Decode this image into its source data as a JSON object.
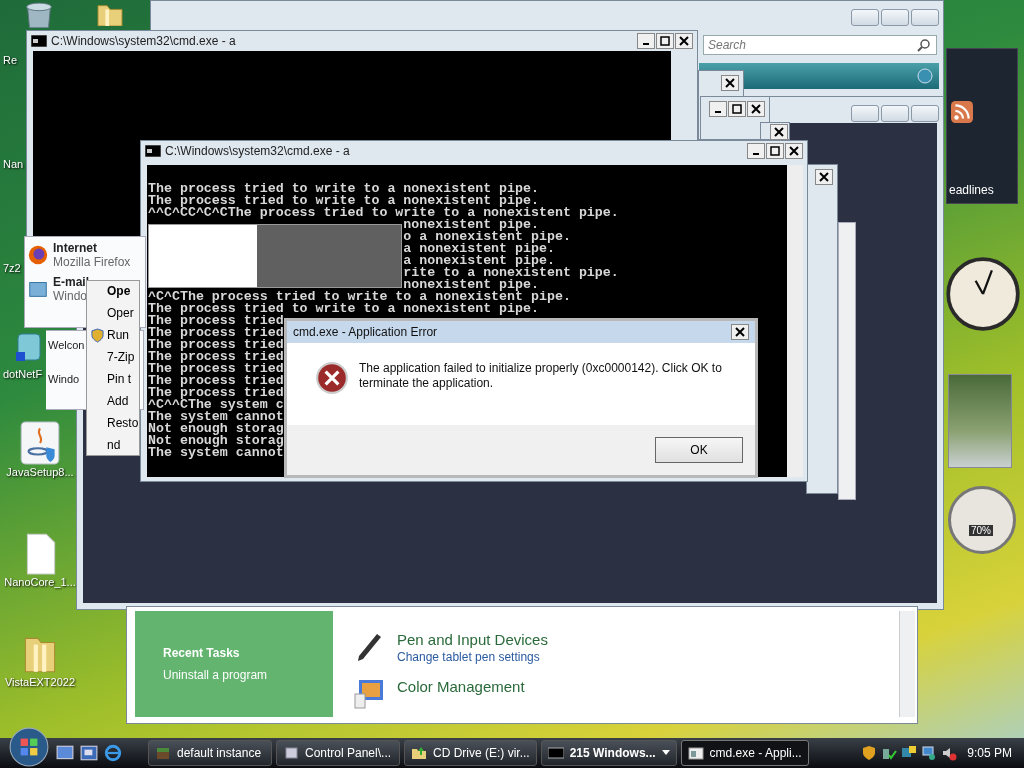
{
  "desktop_icons": [
    {
      "label": "Re",
      "kind": "covered"
    },
    {
      "label": "Nan",
      "kind": "covered"
    },
    {
      "label": "7z2",
      "kind": "covered"
    },
    {
      "label": "dotNetF",
      "kind": "covered"
    },
    {
      "label": "JavaSetup8...",
      "kind": "java"
    },
    {
      "label": "NanoCore_1...",
      "kind": "file"
    },
    {
      "label": "VistaEXT2022",
      "kind": "folder"
    }
  ],
  "control_panel": {
    "search": {
      "placeholder": "Search"
    },
    "recent_tasks": {
      "title": "Recent Tasks",
      "items": [
        "Uninstall a program"
      ]
    },
    "categories": [
      {
        "title": "Pen and Input Devices",
        "link": "Change tablet pen settings",
        "kind": "pen"
      },
      {
        "title": "Color Management",
        "kind": "color"
      }
    ]
  },
  "cmd_back": {
    "title": "C:\\Windows\\system32\\cmd.exe - a"
  },
  "start_menu": {
    "items": [
      {
        "title": "Internet",
        "subtitle": "Mozilla Firefox",
        "kind": "firefox"
      },
      {
        "title": "E-mail",
        "subtitle": "Windo",
        "kind": "mail"
      }
    ]
  },
  "start_menu_fragment": {
    "items": [
      {
        "title": "Welcon",
        "kind": "plain"
      },
      {
        "title": "Windo",
        "kind": "plain"
      }
    ]
  },
  "context_menu": {
    "items": [
      {
        "label": "Ope",
        "kind": "default"
      },
      {
        "label": "Oper",
        "kind": "normal"
      },
      {
        "label": "Run",
        "kind": "elevated"
      },
      {
        "label": "7-Zip",
        "kind": "normal"
      },
      {
        "label": "Pin t",
        "kind": "normal"
      },
      {
        "label": "Add",
        "kind": "normal"
      },
      {
        "label": "Resto",
        "kind": "normal"
      },
      {
        "label": "nd",
        "kind": "normal"
      }
    ]
  },
  "cmd_front": {
    "title": "C:\\Windows\\system32\\cmd.exe - a",
    "lines": [
      "The process tried to write to a nonexistent pipe.",
      "The process tried to write to a nonexistent pipe.",
      "^^C^CC^C^CThe process tried to write to a nonexistent pipe.",
      "                                nonexistent pipe.",
      "                                o a nonexistent pipe.",
      "                                a nonexistent pipe.",
      "                                a nonexistent pipe.",
      "                                rite to a nonexistent pipe.",
      "                                nonexistent pipe.",
      "^C^CThe process tried to write to a nonexistent pipe.",
      "The process tried to write to a nonexistent pipe.",
      "The process tried",
      "The process tried",
      "The process tried",
      "The process tried",
      "The process tried",
      "The process tried",
      "The process tried",
      "^C^^CThe system c",
      "The system cannot",
      "Not enough storag",
      "Not enough storag",
      "The system cannot"
    ]
  },
  "error_dialog": {
    "title": "cmd.exe - Application Error",
    "message": "The application failed to initialize properly (0xc0000142). Click OK to terminate the application.",
    "button": "OK"
  },
  "gadgets": {
    "feed_label": "eadlines",
    "cpu_reading": "70%"
  },
  "taskbar": {
    "tasks": [
      {
        "label": "default instance",
        "kind": "game",
        "selected": false,
        "grouped": false
      },
      {
        "label": "Control Panel\\...",
        "kind": "panel",
        "selected": false,
        "grouped": false
      },
      {
        "label": "CD Drive (E:) vir...",
        "kind": "drive",
        "selected": false,
        "grouped": false
      },
      {
        "label": "215 Windows...",
        "kind": "cmd",
        "selected": false,
        "grouped": true
      },
      {
        "label": "cmd.exe - Appli...",
        "kind": "app",
        "selected": true,
        "grouped": false
      }
    ],
    "clock": "9:05 PM"
  }
}
